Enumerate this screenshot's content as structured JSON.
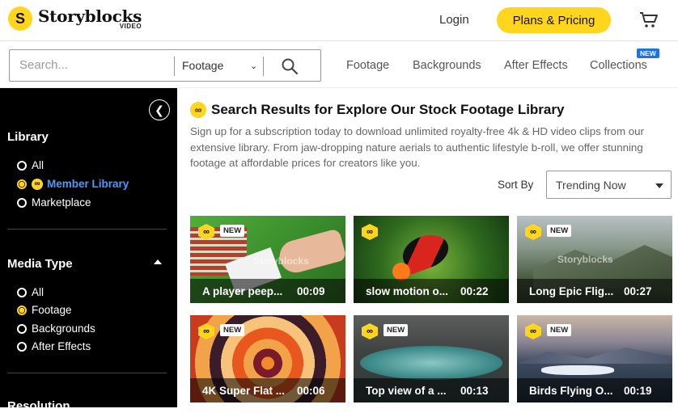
{
  "header": {
    "logo_mark": "S",
    "logo_word": "Storyblocks",
    "logo_sub": "VIDEO",
    "login": "Login",
    "plans": "Plans & Pricing",
    "cart_icon": "cart-icon"
  },
  "search": {
    "placeholder": "Search...",
    "type_value": "Footage",
    "type_chevron": "⌄"
  },
  "nav": {
    "items": [
      "Footage",
      "Backgrounds",
      "After Effects",
      "Collections"
    ],
    "new_badge": "NEW"
  },
  "sidebar": {
    "collapse_glyph": "❮",
    "library": {
      "title": "Library",
      "options": [
        "All",
        "Member Library",
        "Marketplace"
      ],
      "selected": "Member Library"
    },
    "media_type": {
      "title": "Media Type",
      "options": [
        "All",
        "Footage",
        "Backgrounds",
        "After Effects"
      ],
      "selected": "Footage"
    },
    "resolution": {
      "title": "Resolution"
    }
  },
  "main": {
    "title": "Search Results for Explore Our Stock Footage Library",
    "description": "Sign up for a subscription today to download unlimited royalty-free 4k & HD video clips from our extensive library. From jaw-dropping nature aerials to authentic lifestyle b-roll, we offer stunning footage at affordable prices for creators like you.",
    "sort_label": "Sort By",
    "sort_value": "Trending Now",
    "watermark": "Storyblocks",
    "member_glyph": "∞",
    "cards": [
      {
        "title": "A player peep...",
        "duration": "00:09",
        "new": "NEW"
      },
      {
        "title": "slow motion o...",
        "duration": "00:22",
        "new": ""
      },
      {
        "title": "Long Epic Flig...",
        "duration": "00:27",
        "new": "NEW"
      },
      {
        "title": "4K Super Flat ...",
        "duration": "00:06",
        "new": "NEW"
      },
      {
        "title": "Top view of a ...",
        "duration": "00:13",
        "new": "NEW"
      },
      {
        "title": "Birds Flying O...",
        "duration": "00:19",
        "new": "NEW"
      }
    ]
  },
  "colors": {
    "accent": "#ffd51e",
    "link": "#4b9bff",
    "new_badge": "#1a73e8"
  }
}
